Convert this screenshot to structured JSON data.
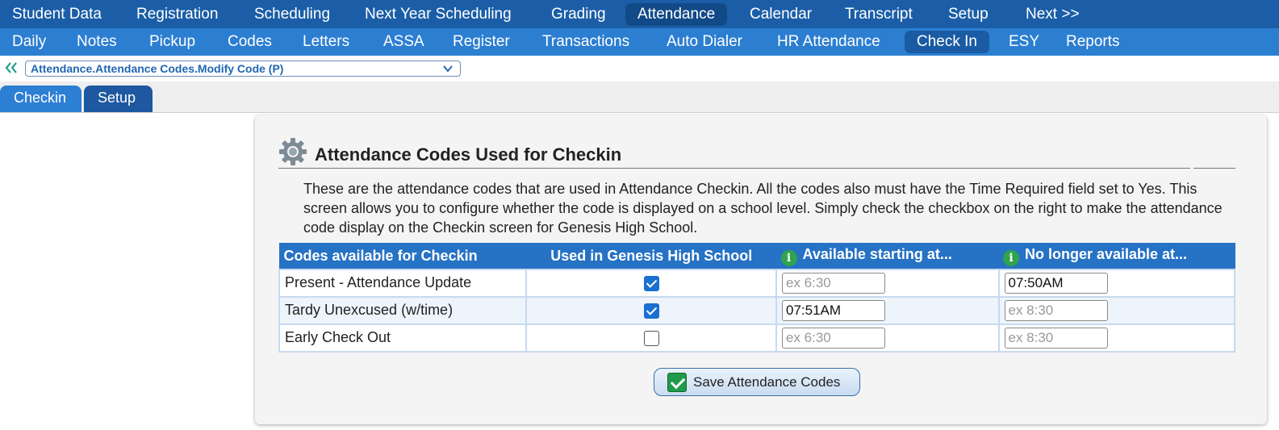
{
  "nav_primary": [
    "Student Data",
    "Registration",
    "Scheduling",
    "Next Year Scheduling",
    "Grading",
    "Attendance",
    "Calendar",
    "Transcript",
    "Setup",
    "Next >>"
  ],
  "nav_primary_active": "Attendance",
  "nav_secondary": [
    "Daily",
    "Notes",
    "Pickup",
    "Codes",
    "Letters",
    "ASSA",
    "Register",
    "Transactions",
    "Auto Dialer",
    "HR Attendance",
    "Check In",
    "ESY",
    "Reports"
  ],
  "nav_secondary_active": "Check In",
  "breadcrumb": {
    "selected": "Attendance.Attendance Codes.Modify Code (P)"
  },
  "tabs": [
    "Checkin",
    "Setup"
  ],
  "panel": {
    "title": "Attendance Codes Used for Checkin",
    "description": "These are the attendance codes that are used in Attendance Checkin. All the codes also must have the Time Required field set to Yes. This screen allows you to configure whether the code is displayed on a school level. Simply check the checkbox on the right to make the attendance code display on the Checkin screen for Genesis High School."
  },
  "table": {
    "headers": [
      "Codes available for Checkin",
      "Used in Genesis High School",
      "Available starting at...",
      "No longer available at..."
    ],
    "info_icon_glyph": "i",
    "rows": [
      {
        "code": "Present - Attendance Update",
        "used": true,
        "start_value": "",
        "start_placeholder": "ex 6:30",
        "end_value": "07:50AM",
        "end_placeholder": "ex 8:30"
      },
      {
        "code": "Tardy Unexcused (w/time)",
        "used": true,
        "start_value": "07:51AM",
        "start_placeholder": "ex 6:30",
        "end_value": "",
        "end_placeholder": "ex 8:30"
      },
      {
        "code": "Early Check Out",
        "used": false,
        "start_value": "",
        "start_placeholder": "ex 6:30",
        "end_value": "",
        "end_placeholder": "ex 8:30"
      }
    ]
  },
  "save_button": {
    "label": "Save Attendance Codes"
  },
  "icons": {
    "back": "double-chevron-left-icon",
    "dropdown": "chevron-down-icon",
    "settings": "gear-icon",
    "info": "info-icon",
    "save": "checkmark-icon"
  },
  "colors": {
    "nav_primary": "#1b5ea7",
    "nav_secondary": "#2c7ed1",
    "table_header": "#2672c4",
    "info_green": "#2fa44f"
  }
}
